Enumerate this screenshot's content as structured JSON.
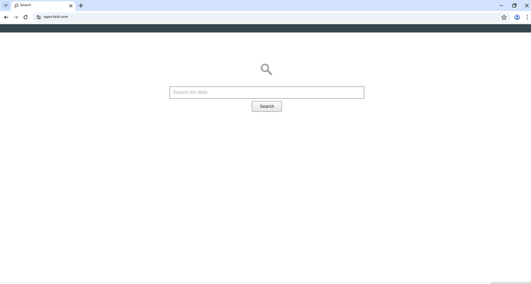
{
  "browser": {
    "tab": {
      "title": "Search",
      "icon": "search-icon"
    },
    "url": "ogarchrdr.com",
    "icons": {
      "tab_search": "chevron-down-icon",
      "tab_close": "close-icon",
      "new_tab": "plus-icon",
      "minimize": "minimize-icon",
      "restore": "restore-icon",
      "close_window": "close-icon",
      "back": "arrow-left-icon",
      "forward": "arrow-right-icon",
      "reload": "reload-icon",
      "site_info": "tune-icon",
      "bookmark": "star-icon",
      "profile": "profile-icon",
      "menu": "more-vertical-icon"
    }
  },
  "page": {
    "search_placeholder": "Search the Web",
    "search_button_label": "Search",
    "icon": "search-icon"
  },
  "colors": {
    "tabstrip": "#d3e3fd",
    "banner": "#37474f",
    "omnibox": "#eef2f9"
  }
}
